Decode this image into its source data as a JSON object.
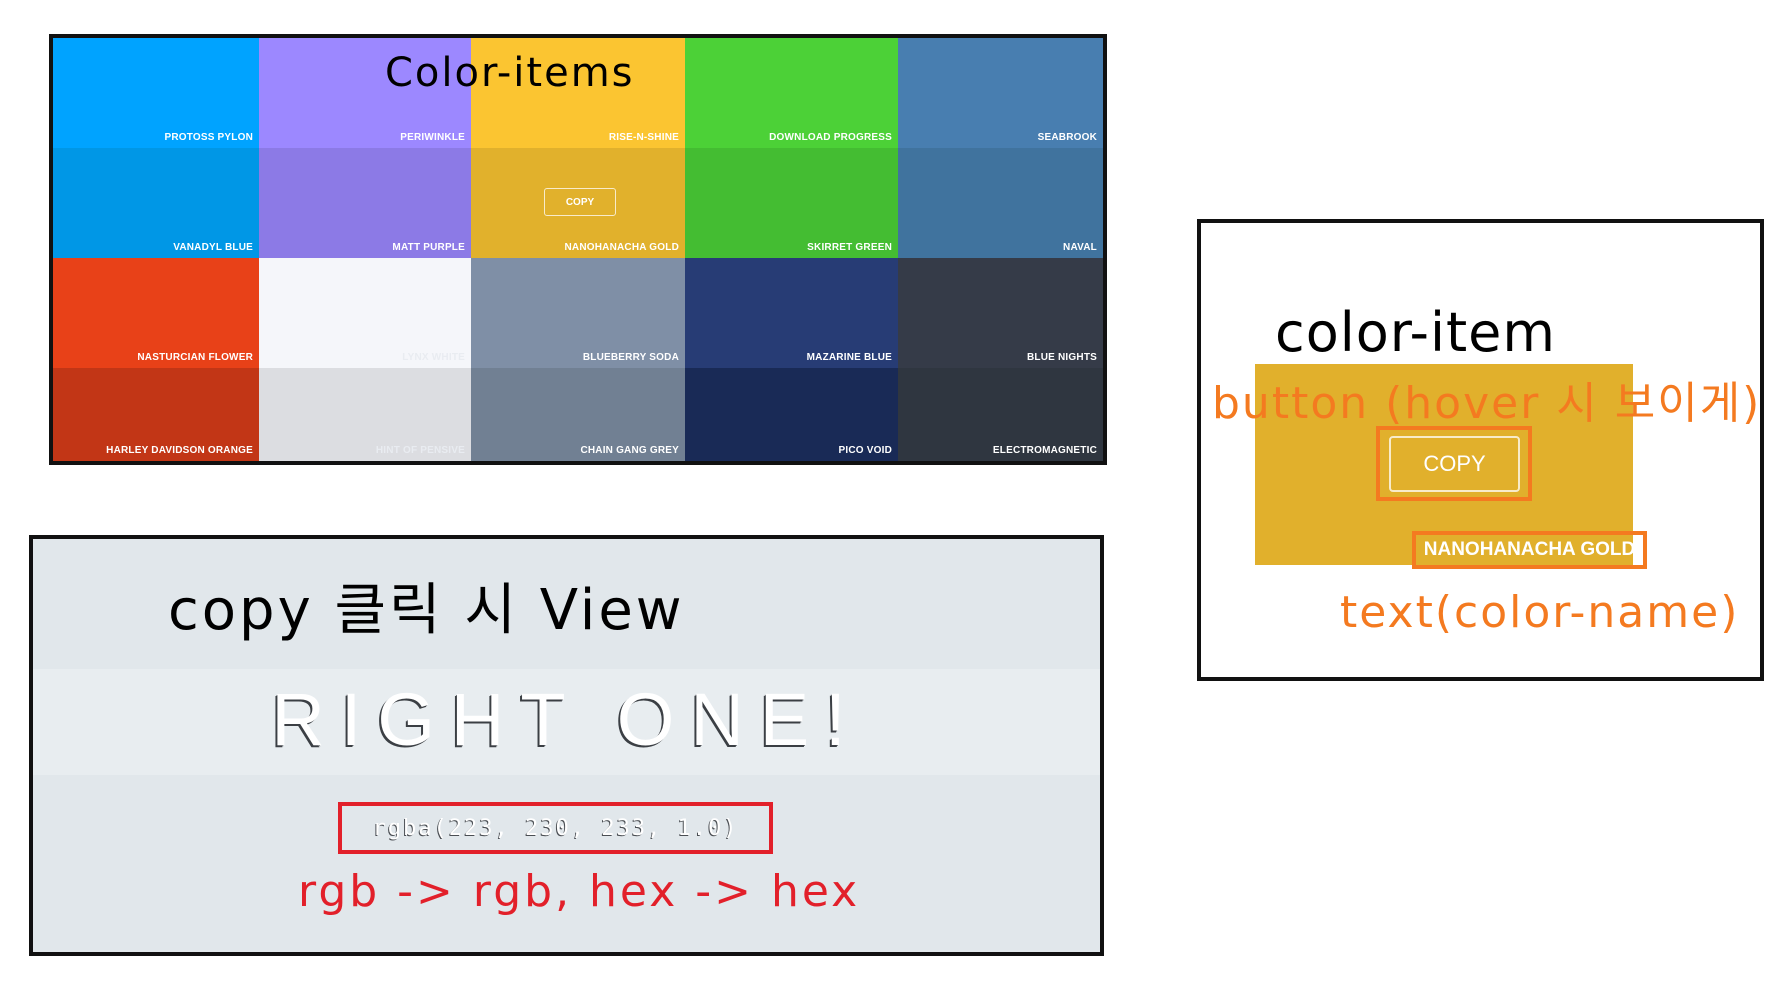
{
  "grid_panel": {
    "title": "Color-items",
    "copy_label": "COPY",
    "cells": [
      {
        "name": "PROTOSS PYLON",
        "color": "#00a3ff"
      },
      {
        "name": "PERIWINKLE",
        "color": "#9c88ff"
      },
      {
        "name": "RISE-N-SHINE",
        "color": "#fbc531"
      },
      {
        "name": "DOWNLOAD PROGRESS",
        "color": "#4cd137"
      },
      {
        "name": "SEABROOK",
        "color": "#487eb0"
      },
      {
        "name": "VANADYL BLUE",
        "color": "#0097e6"
      },
      {
        "name": "MATT PURPLE",
        "color": "#8c7ae6"
      },
      {
        "name": "NANOHANACHA GOLD",
        "color": "#e1b12c"
      },
      {
        "name": "SKIRRET GREEN",
        "color": "#44bd32"
      },
      {
        "name": "NAVAL",
        "color": "#40739e"
      },
      {
        "name": "NASTURCIAN FLOWER",
        "color": "#e84118"
      },
      {
        "name": "LYNX WHITE",
        "color": "#f5f6fa"
      },
      {
        "name": "BLUEBERRY SODA",
        "color": "#7f8fa6"
      },
      {
        "name": "MAZARINE BLUE",
        "color": "#273c75"
      },
      {
        "name": "BLUE NIGHTS",
        "color": "#353b48"
      },
      {
        "name": "HARLEY DAVIDSON ORANGE",
        "color": "#c23616"
      },
      {
        "name": "HINT OF PENSIVE",
        "color": "#dcdde1"
      },
      {
        "name": "CHAIN GANG GREY",
        "color": "#718093"
      },
      {
        "name": "PICO VOID",
        "color": "#192a56"
      },
      {
        "name": "ELECTROMAGNETIC",
        "color": "#2f3640"
      }
    ]
  },
  "view_panel": {
    "title": "copy 클릭 시 View",
    "banner": "RIGHT ONE!",
    "value": "rgba(223, 230, 233, 1.0)",
    "rule": "rgb -> rgb, hex -> hex"
  },
  "item_panel": {
    "title": "color-item",
    "button_note": "button (hover 시 보이게)",
    "copy_label": "COPY",
    "color_name": "NANOHANACHA GOLD",
    "text_note": "text(color-name)"
  },
  "colors": {
    "annotation_orange": "#f47a20",
    "annotation_red": "#e2202a",
    "view_bg": "#e1e7eb"
  }
}
